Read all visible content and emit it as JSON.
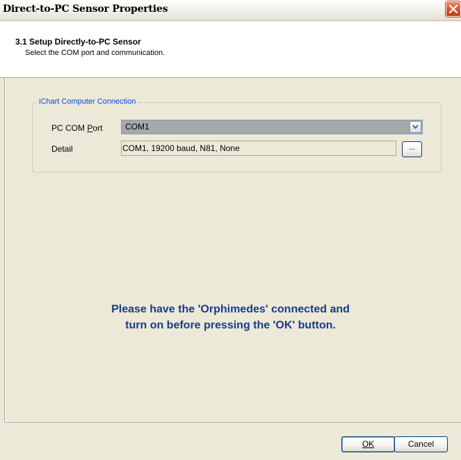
{
  "window": {
    "title": "Direct-to-PC Sensor Properties"
  },
  "header": {
    "title": "3.1 Setup Directly-to-PC Sensor",
    "subtitle": "Select the COM port and communication."
  },
  "connection_group": {
    "legend": "iChart Computer Connection",
    "com_port_label": "PC COM Port",
    "com_port_value": "COM1",
    "detail_label": "Detail",
    "detail_value": "COM1, 19200 baud, N81, None",
    "browse_label": "..."
  },
  "message": {
    "line1": "Please have the 'Orphimedes' connected and",
    "line2": "turn on before pressing the 'OK' button."
  },
  "buttons": {
    "ok_label": "OK",
    "cancel_label": "Cancel"
  },
  "icons": {
    "close": "close-icon",
    "dropdown": "chevron-down-icon"
  },
  "colors": {
    "legend": "#0a49d6",
    "message": "#1a3a8c",
    "close_button": "#d9532b"
  }
}
